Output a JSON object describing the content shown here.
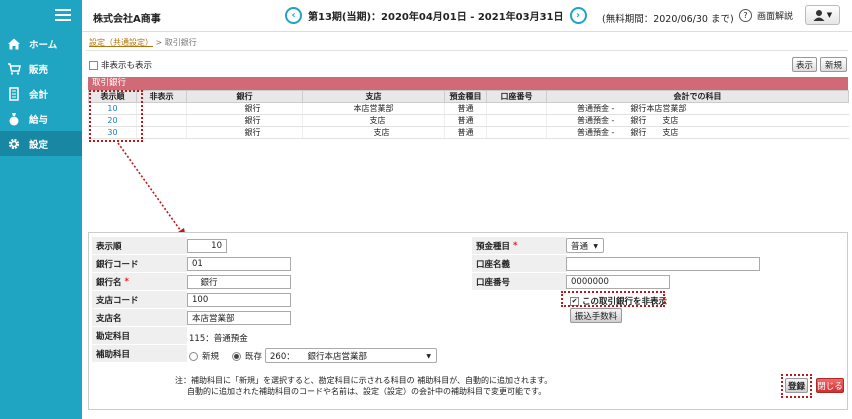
{
  "sidebar": {
    "items": [
      {
        "label": "ホーム",
        "icon": "home-icon"
      },
      {
        "label": "販売",
        "icon": "cart-icon"
      },
      {
        "label": "会計",
        "icon": "ledger-icon"
      },
      {
        "label": "給与",
        "icon": "money-bag-icon"
      },
      {
        "label": "設定",
        "icon": "gear-icon"
      }
    ]
  },
  "header": {
    "company": "株式会社A商事",
    "period": "第13期(当期)：2020年04月01日 - 2021年03月31日",
    "trial": "(無料期間：2020/06/30 まで)",
    "help": "画面解説"
  },
  "breadcrumb": {
    "parent": "設定（共通設定）",
    "separator": " > ",
    "current": "取引銀行"
  },
  "options": {
    "show_hidden": "非表示も表示"
  },
  "toolbar": {
    "show_label": "表示",
    "new_label": "新規"
  },
  "bank_panel": {
    "title": "取引銀行",
    "columns": [
      "表示順",
      "非表示",
      "銀行",
      "支店",
      "預金種目",
      "口座番号",
      "会計での科目"
    ],
    "rows": [
      {
        "order": "10",
        "hidden": "",
        "bank": "　　銀行",
        "branch": "本店営業部",
        "type": "普通",
        "account": "",
        "subject": "普通預金 -　　銀行本店営業部"
      },
      {
        "order": "20",
        "hidden": "",
        "bank": "　　銀行",
        "branch": "　支店",
        "type": "普通",
        "account": "",
        "subject": "普通預金 -　　銀行　　支店"
      },
      {
        "order": "30",
        "hidden": "",
        "bank": "　　銀行",
        "branch": "　　支店",
        "type": "普通",
        "account": "",
        "subject": "普通預金 -　　銀行　　支店"
      }
    ]
  },
  "form": {
    "display_order": {
      "label": "表示順",
      "value": "10"
    },
    "bank_code": {
      "label": "銀行コード",
      "value": "01"
    },
    "bank_name": {
      "label": "銀行名",
      "required": "*",
      "value": "　銀行"
    },
    "branch_code": {
      "label": "支店コード",
      "value": "100"
    },
    "branch_name": {
      "label": "支店名",
      "value": "本店営業部"
    },
    "account_subject": {
      "label": "勘定科目",
      "value": "115：普通預金"
    },
    "sub_subject": {
      "label": "補助科目",
      "opt_new": "新規",
      "opt_existing": "既存",
      "selected": "260：　　銀行本店営業部"
    },
    "deposit_type": {
      "label": "預金種目",
      "required": "*",
      "value": "普通"
    },
    "account_name": {
      "label": "口座名義",
      "value": ""
    },
    "account_number": {
      "label": "口座番号",
      "value": "0000000"
    },
    "hide_bank": {
      "label": "この取引銀行を非表示",
      "checked": "✔"
    },
    "transfer_fee_button": "振込手数料",
    "note_line1": "注：補助科目に「新規」を選択すると、勘定科目に示される科目の 補助科目が、自動的に追加されます。",
    "note_line2": "自動的に追加された補助科目のコードや名前は、設定（設定）の会計中の補助科目で変更可能です。"
  },
  "footer_buttons": {
    "register": "登録",
    "close": "閉じる"
  },
  "colors": {
    "sidebar": "#1fa4c2",
    "panel_header": "#d06a76",
    "close_button": "#d03030",
    "annotation": "#c01818"
  }
}
